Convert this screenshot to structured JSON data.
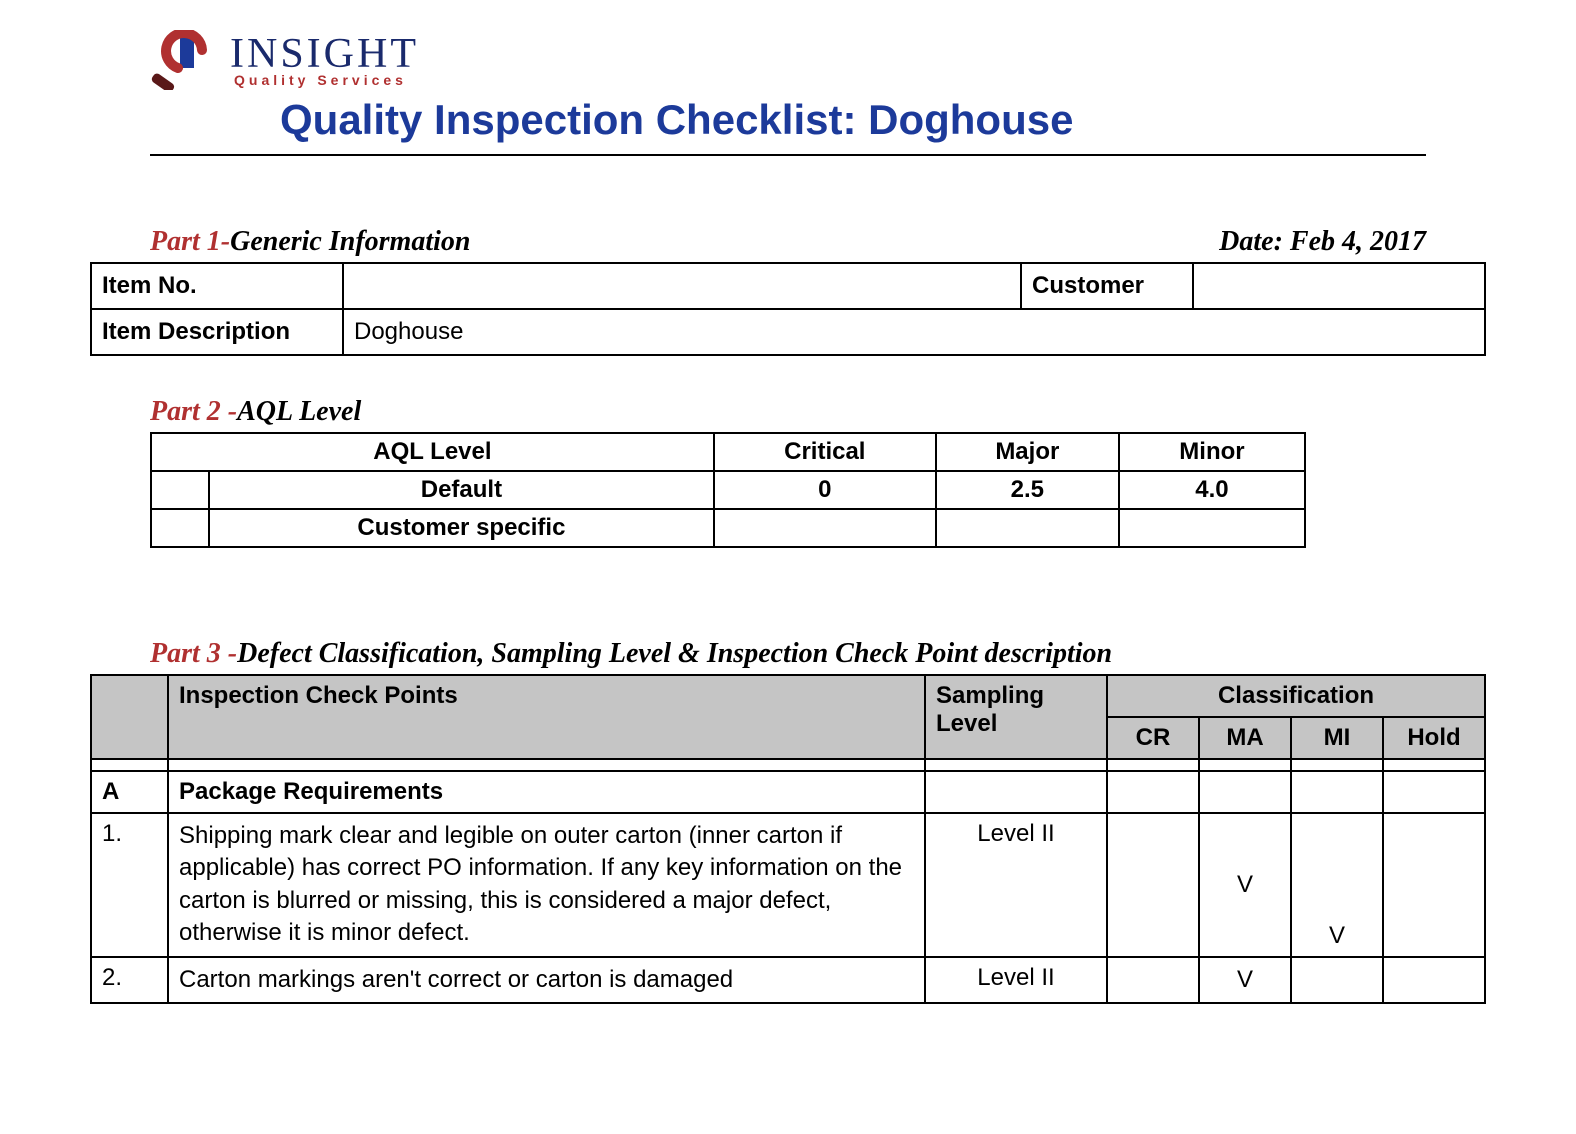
{
  "logo": {
    "brand": "INSIGHT",
    "subtitle": "Quality Services"
  },
  "title": "Quality Inspection Checklist: Doghouse",
  "part1": {
    "partNum": "Part 1-",
    "partTitle": "Generic Information",
    "dateLabel": "Date: Feb 4, 2017",
    "rows": {
      "itemNoLabel": "Item No.",
      "itemNoValue": "",
      "customerLabel": "Customer",
      "customerValue": "",
      "itemDescLabel": "Item Description",
      "itemDescValue": "Doghouse"
    }
  },
  "part2": {
    "partNum": "Part 2 -",
    "partTitle": "AQL Level",
    "headers": {
      "aql": "AQL Level",
      "critical": "Critical",
      "major": "Major",
      "minor": "Minor"
    },
    "rows": [
      {
        "label": "Default",
        "critical": "0",
        "major": "2.5",
        "minor": "4.0"
      },
      {
        "label": "Customer specific",
        "critical": "",
        "major": "",
        "minor": ""
      }
    ]
  },
  "part3": {
    "partNum": "Part 3 -",
    "partTitle": "Defect Classification, Sampling Level & Inspection Check Point description",
    "headers": {
      "checkPoints": "Inspection Check Points",
      "sampling": "Sampling Level",
      "classification": "Classification",
      "cr": "CR",
      "ma": "MA",
      "mi": "MI",
      "hold": "Hold"
    },
    "sectionA": {
      "letter": "A",
      "title": "Package Requirements"
    },
    "rows": [
      {
        "num": "1.",
        "desc": "Shipping mark clear and legible on outer carton (inner carton if applicable) has correct PO information. If any key information on the carton is blurred or missing, this is considered a major defect, otherwise it is minor defect.",
        "sampling": "Level II",
        "cr": "",
        "ma": "V",
        "mi": "V",
        "hold": ""
      },
      {
        "num": "2.",
        "desc": "Carton markings aren't correct or carton is damaged",
        "sampling": "Level II",
        "cr": "",
        "ma": "V",
        "mi": "",
        "hold": ""
      }
    ]
  }
}
